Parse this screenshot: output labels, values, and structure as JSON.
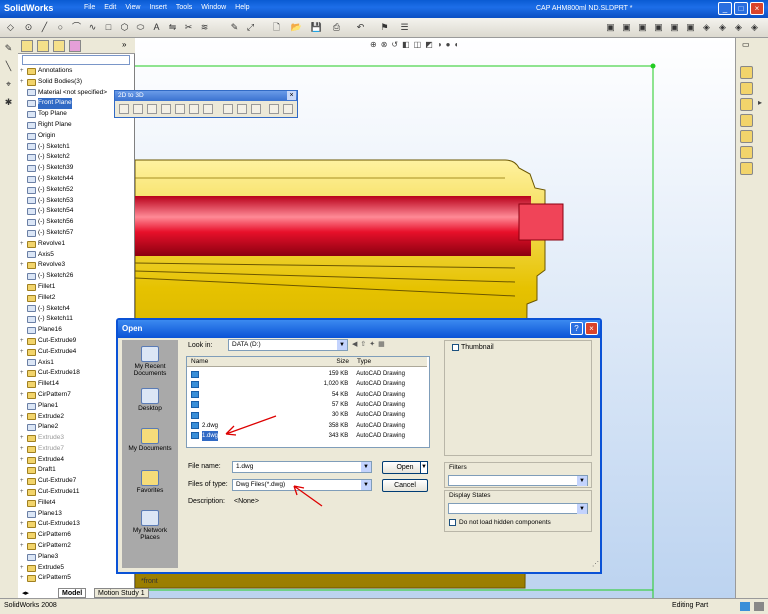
{
  "app": {
    "logo": "SolidWorks",
    "document_title": "CAP AHM800ml ND.SLDPRT *"
  },
  "menu": [
    "File",
    "Edit",
    "View",
    "Insert",
    "Tools",
    "Window",
    "Help"
  ],
  "window_controls": {
    "minimize": "_",
    "restore": "□",
    "close": "×"
  },
  "feature_tree": [
    {
      "label": "Annotations",
      "expand": "+",
      "icon": "annotations-icon",
      "state": "normal"
    },
    {
      "label": "Solid Bodies(3)",
      "expand": "+",
      "icon": "solid-bodies-icon",
      "state": "normal"
    },
    {
      "label": "Material <not specified>",
      "expand": "",
      "icon": "material-icon",
      "state": "normal"
    },
    {
      "label": "Front Plane",
      "expand": "",
      "icon": "plane-icon",
      "state": "selected"
    },
    {
      "label": "Top Plane",
      "expand": "",
      "icon": "plane-icon",
      "state": "normal"
    },
    {
      "label": "Right Plane",
      "expand": "",
      "icon": "plane-icon",
      "state": "normal"
    },
    {
      "label": "Origin",
      "expand": "",
      "icon": "origin-icon",
      "state": "normal"
    },
    {
      "label": "(-) Sketch1",
      "expand": "",
      "icon": "sketch-icon",
      "state": "normal"
    },
    {
      "label": "(-) Sketch2",
      "expand": "",
      "icon": "sketch-icon",
      "state": "normal"
    },
    {
      "label": "(-) Sketch39",
      "expand": "",
      "icon": "sketch-icon",
      "state": "normal"
    },
    {
      "label": "(-) Sketch44",
      "expand": "",
      "icon": "sketch-icon",
      "state": "normal"
    },
    {
      "label": "(-) Sketch52",
      "expand": "",
      "icon": "sketch-icon",
      "state": "normal"
    },
    {
      "label": "(-) Sketch53",
      "expand": "",
      "icon": "sketch-icon",
      "state": "normal"
    },
    {
      "label": "(-) Sketch54",
      "expand": "",
      "icon": "sketch-icon",
      "state": "normal"
    },
    {
      "label": "(-) Sketch56",
      "expand": "",
      "icon": "sketch-icon",
      "state": "normal"
    },
    {
      "label": "(-) Sketch57",
      "expand": "",
      "icon": "sketch-icon",
      "state": "normal"
    },
    {
      "label": "Revolve1",
      "expand": "+",
      "icon": "revolve-icon",
      "state": "normal"
    },
    {
      "label": "Axis5",
      "expand": "",
      "icon": "axis-icon",
      "state": "normal"
    },
    {
      "label": "Revolve3",
      "expand": "+",
      "icon": "revolve-icon",
      "state": "normal"
    },
    {
      "label": "(-) Sketch26",
      "expand": "",
      "icon": "sketch-icon",
      "state": "normal"
    },
    {
      "label": "Fillet1",
      "expand": "",
      "icon": "fillet-icon",
      "state": "normal"
    },
    {
      "label": "Fillet2",
      "expand": "",
      "icon": "fillet-icon",
      "state": "normal"
    },
    {
      "label": "(-) Sketch4",
      "expand": "",
      "icon": "sketch-icon",
      "state": "normal"
    },
    {
      "label": "(-) Sketch11",
      "expand": "",
      "icon": "sketch-icon",
      "state": "normal"
    },
    {
      "label": "Plane16",
      "expand": "",
      "icon": "plane-icon",
      "state": "normal"
    },
    {
      "label": "Cut-Extrude9",
      "expand": "+",
      "icon": "cut-extrude-icon",
      "state": "normal"
    },
    {
      "label": "Cut-Extrude4",
      "expand": "+",
      "icon": "cut-extrude-icon",
      "state": "normal"
    },
    {
      "label": "Axis1",
      "expand": "",
      "icon": "axis-icon",
      "state": "normal"
    },
    {
      "label": "Cut-Extrude18",
      "expand": "+",
      "icon": "cut-extrude-icon",
      "state": "normal"
    },
    {
      "label": "Fillet14",
      "expand": "",
      "icon": "fillet-icon",
      "state": "normal"
    },
    {
      "label": "CirPattern7",
      "expand": "+",
      "icon": "pattern-icon",
      "state": "normal"
    },
    {
      "label": "Plane1",
      "expand": "",
      "icon": "plane-icon",
      "state": "normal"
    },
    {
      "label": "Extrude2",
      "expand": "+",
      "icon": "extrude-icon",
      "state": "normal"
    },
    {
      "label": "Plane2",
      "expand": "",
      "icon": "plane-icon",
      "state": "normal"
    },
    {
      "label": "Extrude3",
      "expand": "+",
      "icon": "extrude-icon",
      "state": "dim"
    },
    {
      "label": "Extrude7",
      "expand": "+",
      "icon": "extrude-icon",
      "state": "dim"
    },
    {
      "label": "Extrude4",
      "expand": "+",
      "icon": "extrude-icon",
      "state": "normal"
    },
    {
      "label": "Draft1",
      "expand": "",
      "icon": "draft-icon",
      "state": "normal"
    },
    {
      "label": "Cut-Extrude7",
      "expand": "+",
      "icon": "cut-extrude-icon",
      "state": "normal"
    },
    {
      "label": "Cut-Extrude11",
      "expand": "+",
      "icon": "cut-extrude-icon",
      "state": "normal"
    },
    {
      "label": "Fillet4",
      "expand": "",
      "icon": "fillet-icon",
      "state": "normal"
    },
    {
      "label": "Plane13",
      "expand": "",
      "icon": "plane-icon",
      "state": "normal"
    },
    {
      "label": "Cut-Extrude13",
      "expand": "+",
      "icon": "cut-extrude-icon",
      "state": "normal"
    },
    {
      "label": "CirPattern6",
      "expand": "+",
      "icon": "pattern-icon",
      "state": "normal"
    },
    {
      "label": "CirPattern2",
      "expand": "+",
      "icon": "pattern-icon",
      "state": "normal"
    },
    {
      "label": "Plane3",
      "expand": "",
      "icon": "plane-icon",
      "state": "normal"
    },
    {
      "label": "Extrude5",
      "expand": "+",
      "icon": "extrude-icon",
      "state": "normal"
    },
    {
      "label": "CirPattern5",
      "expand": "+",
      "icon": "pattern-icon",
      "state": "normal"
    }
  ],
  "float_toolbar": {
    "title": "2D to 3D"
  },
  "bottom_tabs": [
    "Model",
    "Motion Study 1"
  ],
  "viewport": {
    "view_label": "*front"
  },
  "status": {
    "left": "SolidWorks 2008",
    "right": "Editing Part"
  },
  "dialog": {
    "title": "Open",
    "places": [
      "My Recent Documents",
      "Desktop",
      "My Documents",
      "Favorites",
      "My Network Places"
    ],
    "look_in_label": "Look in:",
    "look_in_value": "DATA (D:)",
    "columns": [
      "Name",
      "Size",
      "Type"
    ],
    "files": [
      {
        "name": "",
        "size": "159 KB",
        "type": "AutoCAD Drawing",
        "selected": false
      },
      {
        "name": "",
        "size": "1,020 KB",
        "type": "AutoCAD Drawing",
        "selected": false
      },
      {
        "name": "",
        "size": "54 KB",
        "type": "AutoCAD Drawing",
        "selected": false
      },
      {
        "name": "",
        "size": "57 KB",
        "type": "AutoCAD Drawing",
        "selected": false
      },
      {
        "name": "",
        "size": "30 KB",
        "type": "AutoCAD Drawing",
        "selected": false
      },
      {
        "name": "2.dwg",
        "size": "358 KB",
        "type": "AutoCAD Drawing",
        "selected": false
      },
      {
        "name": "1.dwg",
        "size": "343 KB",
        "type": "AutoCAD Drawing",
        "selected": true
      }
    ],
    "file_name_label": "File name:",
    "file_name_value": "1.dwg",
    "files_of_type_label": "Files of type:",
    "files_of_type_value": "Dwg Files(*.dwg)",
    "description_label": "Description:",
    "description_value": "<None>",
    "open_label": "Open",
    "cancel_label": "Cancel",
    "thumbnail_label": "Thumbnail",
    "filters_label": "Filters",
    "display_states_label": "Display States",
    "hidden_components_label": "Do not load hidden components"
  },
  "colors": {
    "title_blue": "#0a52d6",
    "selection": "#316ac5",
    "part_gold": "#e6c200",
    "part_red": "#e8102a",
    "sketch_green": "#22cc22"
  }
}
